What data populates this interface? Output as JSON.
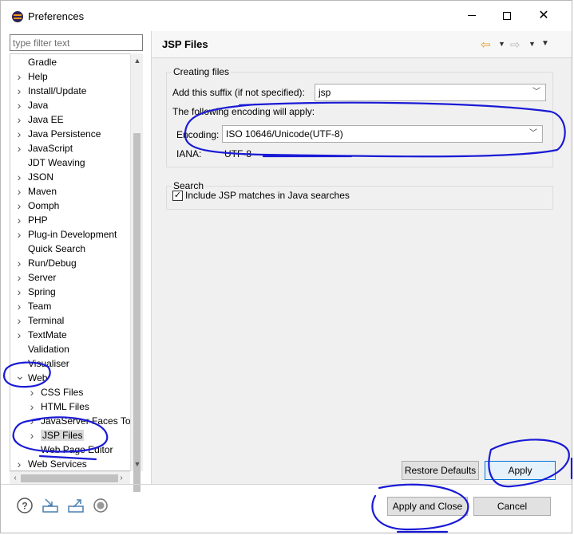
{
  "window": {
    "title": "Preferences"
  },
  "filter": {
    "placeholder": "type filter text"
  },
  "tree": {
    "items": [
      {
        "label": "Gradle",
        "expandable": false
      },
      {
        "label": "Help",
        "expandable": true
      },
      {
        "label": "Install/Update",
        "expandable": true
      },
      {
        "label": "Java",
        "expandable": true
      },
      {
        "label": "Java EE",
        "expandable": true
      },
      {
        "label": "Java Persistence",
        "expandable": true
      },
      {
        "label": "JavaScript",
        "expandable": true
      },
      {
        "label": "JDT Weaving",
        "expandable": false
      },
      {
        "label": "JSON",
        "expandable": true
      },
      {
        "label": "Maven",
        "expandable": true
      },
      {
        "label": "Oomph",
        "expandable": true
      },
      {
        "label": "PHP",
        "expandable": true
      },
      {
        "label": "Plug-in Development",
        "expandable": true
      },
      {
        "label": "Quick Search",
        "expandable": false
      },
      {
        "label": "Run/Debug",
        "expandable": true
      },
      {
        "label": "Server",
        "expandable": true
      },
      {
        "label": "Spring",
        "expandable": true
      },
      {
        "label": "Team",
        "expandable": true
      },
      {
        "label": "Terminal",
        "expandable": true
      },
      {
        "label": "TextMate",
        "expandable": true
      },
      {
        "label": "Validation",
        "expandable": false
      },
      {
        "label": "Visualiser",
        "expandable": false
      },
      {
        "label": "Web",
        "expandable": true,
        "expanded": true
      },
      {
        "label": "CSS Files",
        "expandable": true,
        "child": true
      },
      {
        "label": "HTML Files",
        "expandable": true,
        "child": true
      },
      {
        "label": "JavaServer Faces Too",
        "expandable": true,
        "child": true
      },
      {
        "label": "JSP Files",
        "expandable": true,
        "child": true,
        "selected": true
      },
      {
        "label": "Web Page Editor",
        "expandable": false,
        "child": true
      },
      {
        "label": "Web Services",
        "expandable": true
      }
    ]
  },
  "page": {
    "title": "JSP Files",
    "creating": {
      "group_title": "Creating files",
      "suffix_label": "Add this suffix (if not specified):",
      "suffix_value": "jsp",
      "encoding_intro": "The following encoding will apply:",
      "encoding_label": "Encoding:",
      "encoding_value": "ISO 10646/Unicode(UTF-8)",
      "iana_label": "IANA:",
      "iana_value": "UTF-8"
    },
    "search": {
      "group_title": "Search",
      "include_label": "Include JSP matches in Java searches",
      "include_checked": true
    }
  },
  "buttons": {
    "restore_defaults": "Restore Defaults",
    "apply": "Apply",
    "apply_and_close": "Apply and Close",
    "cancel": "Cancel"
  },
  "colors": {
    "annotation_ink": "#1a1ad6",
    "default_button_border": "#0078d7"
  }
}
